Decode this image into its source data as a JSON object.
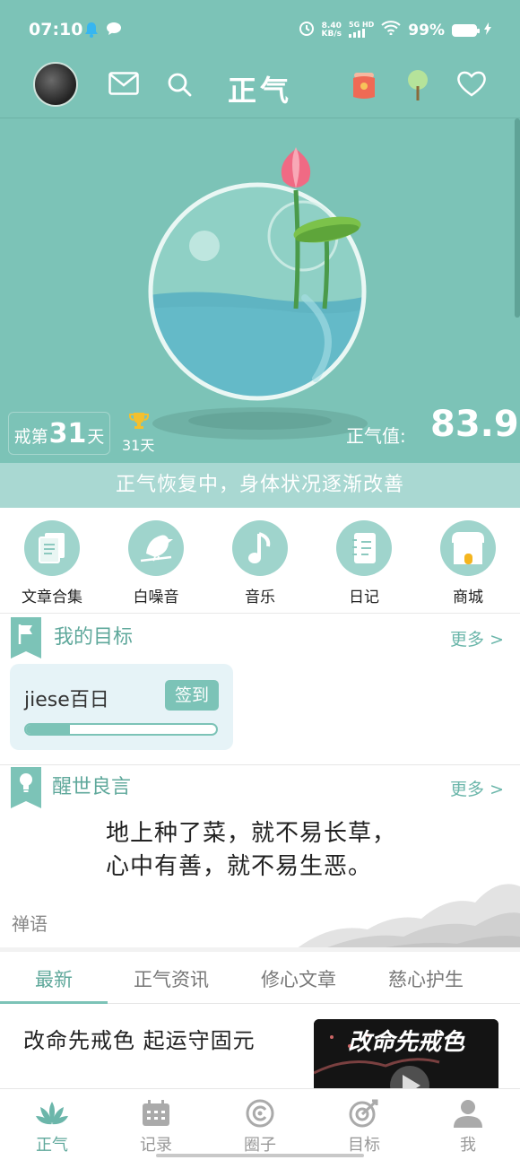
{
  "status_bar": {
    "time": "07:10",
    "speed_value": "8.40",
    "speed_unit": "KB/s",
    "network": "5G HD",
    "battery": "99%"
  },
  "appbar": {
    "title": "正气"
  },
  "hero": {
    "streak_prefix": "戒第",
    "streak_days": "31",
    "streak_suffix": "天",
    "trophy_days": "31天",
    "qi_label": "正气值:",
    "qi_value": "83.9",
    "status_text": "正气恢复中，身体状况逐渐改善"
  },
  "quick_menu": [
    {
      "label": "文章合集",
      "icon": "document-icon"
    },
    {
      "label": "白噪音",
      "icon": "bird-icon"
    },
    {
      "label": "音乐",
      "icon": "music-note-icon"
    },
    {
      "label": "日记",
      "icon": "notebook-icon"
    },
    {
      "label": "商城",
      "icon": "shop-icon"
    }
  ],
  "goals": {
    "title": "我的目标",
    "more": "更多 >",
    "card": {
      "name": "jiese百日",
      "checkin_label": "签到",
      "progress": 0.23
    }
  },
  "quotes": {
    "title": "醒世良言",
    "more": "更多 >",
    "line1": "地上种了菜，就不易长草，",
    "line2": "心中有善，就不易生恶。",
    "category": "禅语"
  },
  "tabs": [
    "最新",
    "正气资讯",
    "修心文章",
    "慈心护生"
  ],
  "article": {
    "title": "改命先戒色 起运守固元",
    "thumb_text": "改命先戒色"
  },
  "bottom_nav": [
    {
      "label": "正气",
      "icon": "lotus-icon",
      "active": true
    },
    {
      "label": "记录",
      "icon": "calendar-icon",
      "active": false
    },
    {
      "label": "圈子",
      "icon": "circle-icon",
      "active": false
    },
    {
      "label": "目标",
      "icon": "target-icon",
      "active": false
    },
    {
      "label": "我",
      "icon": "person-icon",
      "active": false
    }
  ],
  "colors": {
    "primary": "#7cc3b7",
    "strip": "#a9d8d2",
    "accent_text": "#5fa89b"
  }
}
